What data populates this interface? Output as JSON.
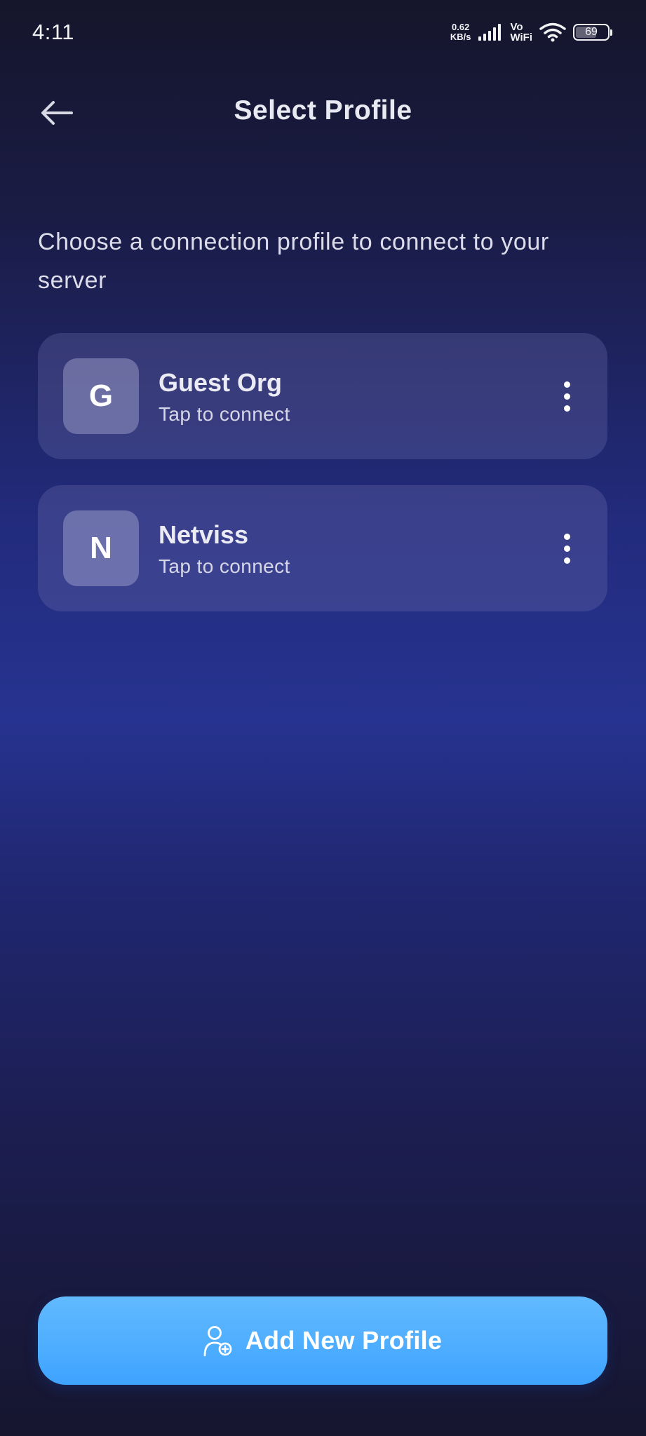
{
  "status_bar": {
    "time": "4:11",
    "net_speed_value": "0.62",
    "net_speed_unit": "KB/s",
    "vo": "Vo",
    "wifi_label": "WiFi",
    "battery_level": "69",
    "battery_fraction": 0.69
  },
  "header": {
    "title": "Select Profile",
    "back_icon": "arrow-left-icon"
  },
  "description": "Choose a connection profile to connect to your server",
  "profiles": [
    {
      "initial": "G",
      "name": "Guest Org",
      "subtitle": "Tap to connect",
      "menu_icon": "more-vertical-icon"
    },
    {
      "initial": "N",
      "name": "Netviss",
      "subtitle": "Tap to connect",
      "menu_icon": "more-vertical-icon"
    }
  ],
  "add_button": {
    "label": "Add New Profile",
    "icon": "add-user-icon"
  },
  "colors": {
    "accent": "#3ea3ff",
    "background_top": "#15152b",
    "background_mid": "#263390",
    "card": "#3b3d7a"
  }
}
